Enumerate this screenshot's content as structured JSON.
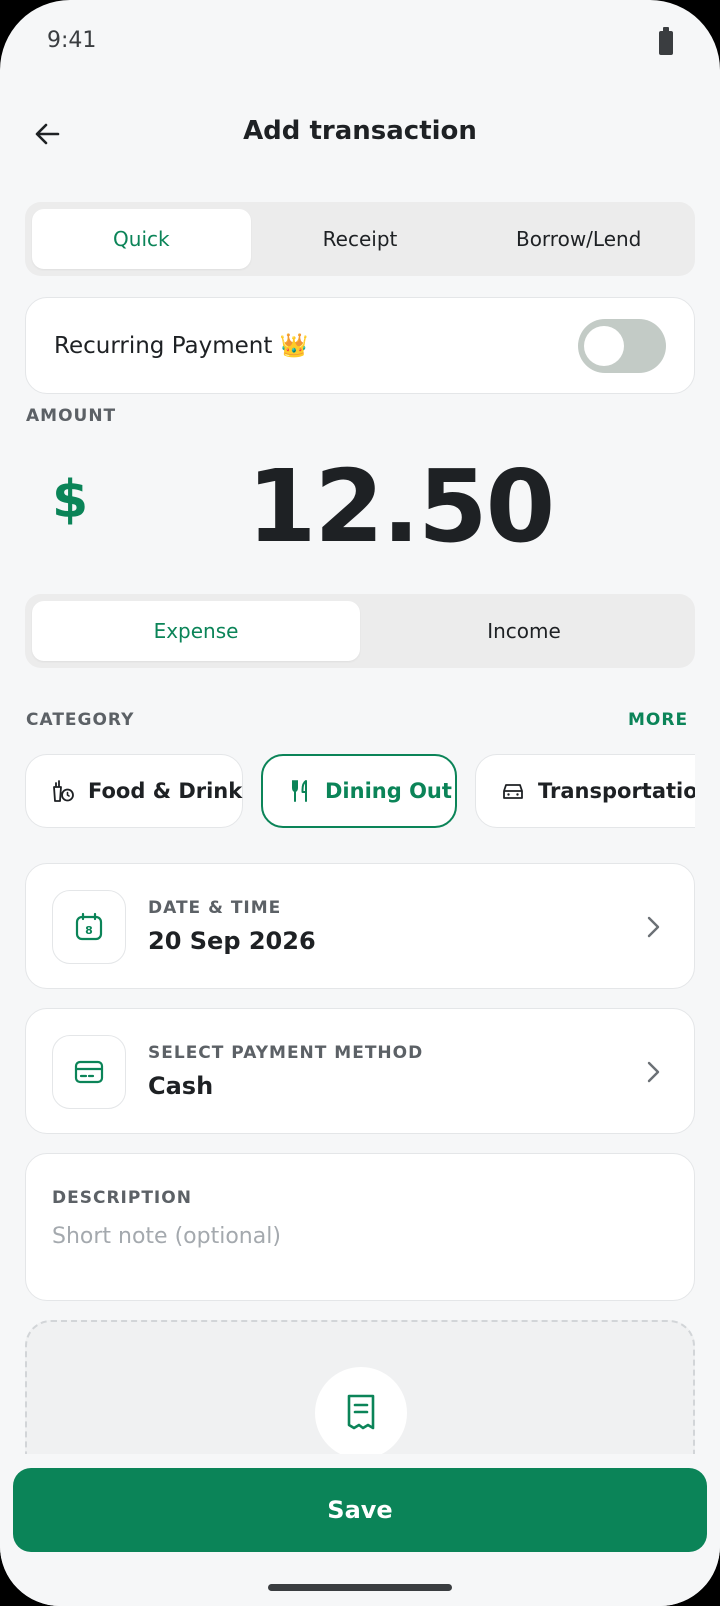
{
  "status_bar": {
    "time": "9:41"
  },
  "header": {
    "title": "Add transaction"
  },
  "mode_tabs": [
    {
      "label": "Quick",
      "active": true
    },
    {
      "label": "Receipt",
      "active": false
    },
    {
      "label": "Borrow/Lend",
      "active": false
    }
  ],
  "recurring": {
    "label": "Recurring Payment",
    "badge": "👑",
    "enabled": false
  },
  "amount": {
    "label": "AMOUNT",
    "currency": "$",
    "value": "12.50"
  },
  "type_tabs": [
    {
      "label": "Expense",
      "active": true
    },
    {
      "label": "Income",
      "active": false
    }
  ],
  "category": {
    "label": "CATEGORY",
    "more_label": "MORE",
    "items": [
      {
        "label": "Food & Drink",
        "icon": "food-drink-icon",
        "selected": false
      },
      {
        "label": "Dining Out",
        "icon": "fork-knife-icon",
        "selected": true
      },
      {
        "label": "Transportation",
        "icon": "car-icon",
        "selected": false
      }
    ]
  },
  "date_time": {
    "label": "DATE & TIME",
    "value": "20 Sep 2026",
    "calendar_day": "8",
    "icon": "calendar-icon"
  },
  "payment_method": {
    "label": "SELECT PAYMENT METHOD",
    "value": "Cash",
    "icon": "credit-card-icon"
  },
  "description": {
    "label": "DESCRIPTION",
    "placeholder": "Short note (optional)",
    "value": ""
  },
  "receipt": {
    "icon": "receipt-icon"
  },
  "save": {
    "label": "Save"
  },
  "colors": {
    "accent": "#0b8458",
    "background": "#f6f7f8",
    "toggle_off": "#c3cbc6"
  }
}
